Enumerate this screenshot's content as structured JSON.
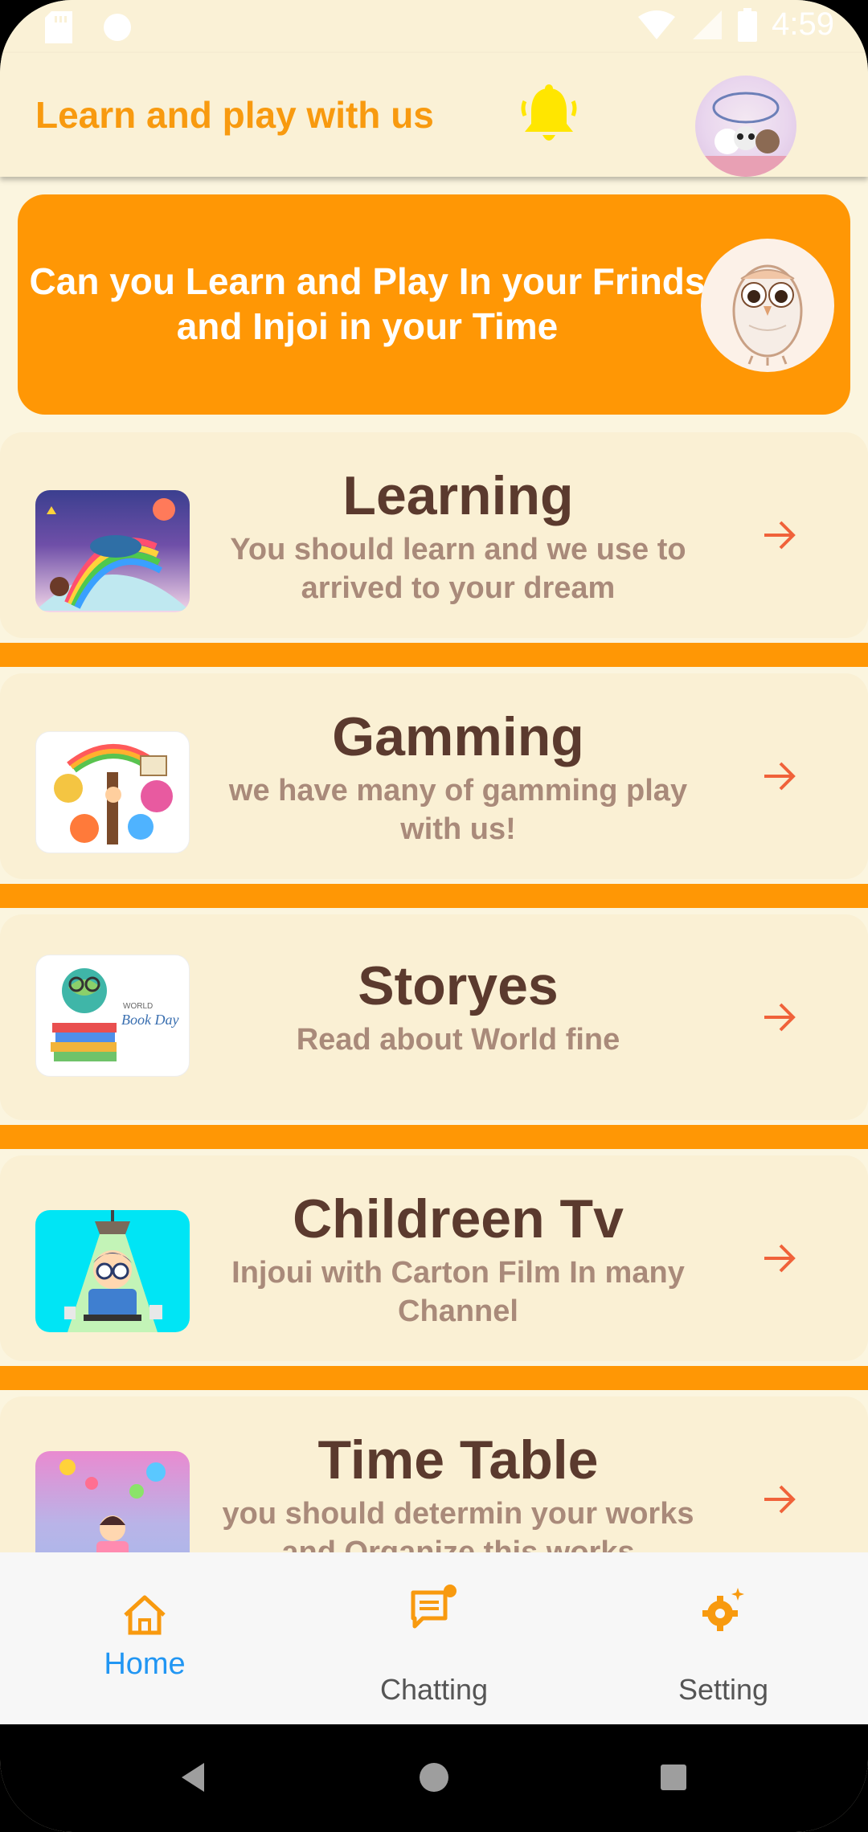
{
  "status_bar": {
    "time": "4:59"
  },
  "app_bar": {
    "title": "Learn and play with us"
  },
  "banner": {
    "text": "Can you Learn and Play In your Frinds and Injoi in your Time"
  },
  "cards": [
    {
      "title": "Learning",
      "subtitle": "You should learn and we use to arrived to your dream"
    },
    {
      "title": "Gamming",
      "subtitle": "we have many of gamming play with us!"
    },
    {
      "title": "Storyes",
      "subtitle": "Read about World fine"
    },
    {
      "title": "Childreen Tv",
      "subtitle": "Injoui with Carton Film In many Channel"
    },
    {
      "title": "Time Table",
      "subtitle": "you should determin your works and Organize this works"
    }
  ],
  "bottom_nav": {
    "items": [
      {
        "label": "Home",
        "icon": "home-icon",
        "active": true
      },
      {
        "label": "Chatting",
        "icon": "chat-icon",
        "active": false
      },
      {
        "label": "Setting",
        "icon": "settings-icon",
        "active": false
      }
    ]
  },
  "colors": {
    "accent": "#FF9705",
    "active_nav": "#2196F3",
    "card_bg": "#FAF0D4",
    "title_brown": "#5B3A2E"
  },
  "thumbs": {
    "learning": {
      "text": ""
    },
    "storyes": {
      "text_world": "WORLD",
      "text_book": "Book Day"
    }
  }
}
